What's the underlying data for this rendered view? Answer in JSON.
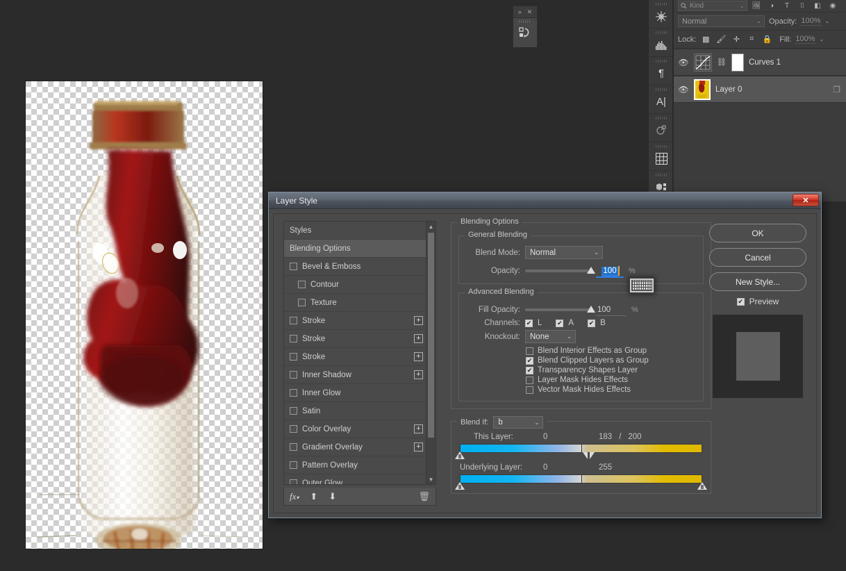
{
  "app": {
    "background_color": "#2b2b2b",
    "accent_color": "#2472c8"
  },
  "mini_panel": {
    "name": "actions-panel-collapsed",
    "expand_icon": "double-chevron-right-icon",
    "close_icon": "close-icon",
    "body_icon": "actions-icon"
  },
  "rail": {
    "items": [
      {
        "name": "color-panel",
        "glyph": "✳"
      },
      {
        "name": "histogram-panel",
        "glyph": "▥"
      },
      {
        "name": "paragraph-panel",
        "glyph": "¶"
      },
      {
        "name": "character-panel",
        "glyph": "A"
      },
      {
        "name": "paths-panel",
        "glyph": "⊛"
      },
      {
        "name": "swatches-panel",
        "glyph": "▦"
      },
      {
        "name": "3d-panel",
        "glyph": "◈"
      }
    ]
  },
  "layers_panel": {
    "filter": {
      "search_icon": "search-icon",
      "kind_label": "Kind",
      "chevron": "⌄",
      "type_icons": [
        "pixel-filter-icon",
        "adjustment-filter-icon",
        "type-filter-icon",
        "shape-filter-icon",
        "smart-object-filter-icon",
        "filter-toggle-icon"
      ]
    },
    "blend_mode": "Normal",
    "opacity_label": "Opacity:",
    "opacity_value": "100%",
    "lock_label": "Lock:",
    "lock_icons": [
      "lock-transparency-icon",
      "lock-image-icon",
      "lock-position-icon",
      "lock-artboard-icon",
      "lock-all-icon"
    ],
    "fill_label": "Fill:",
    "fill_value": "100%",
    "layers": [
      {
        "name": "Curves 1",
        "visible_icon": "eye-icon",
        "thumb": "curves-adjustment-icon",
        "link_icon": "link-icon",
        "has_mask": true,
        "selected": false,
        "clipped": false
      },
      {
        "name": "Layer 0",
        "visible_icon": "eye-icon",
        "thumb": "layer-thumbnail",
        "selected": true,
        "clipped": true,
        "clip_icon": "clipping-mask-icon"
      }
    ]
  },
  "dialog": {
    "title": "Layer Style",
    "close_icon": "close-icon",
    "styles": {
      "header": "Styles",
      "items": [
        {
          "label": "Blending Options",
          "checkbox": false,
          "active": true,
          "plus": false,
          "indent": false
        },
        {
          "label": "Bevel & Emboss",
          "checkbox": true,
          "checked": false,
          "plus": false,
          "indent": false
        },
        {
          "label": "Contour",
          "checkbox": true,
          "checked": false,
          "plus": false,
          "indent": true
        },
        {
          "label": "Texture",
          "checkbox": true,
          "checked": false,
          "plus": false,
          "indent": true
        },
        {
          "label": "Stroke",
          "checkbox": true,
          "checked": false,
          "plus": true,
          "indent": false
        },
        {
          "label": "Stroke",
          "checkbox": true,
          "checked": false,
          "plus": true,
          "indent": false
        },
        {
          "label": "Stroke",
          "checkbox": true,
          "checked": false,
          "plus": true,
          "indent": false
        },
        {
          "label": "Inner Shadow",
          "checkbox": true,
          "checked": false,
          "plus": true,
          "indent": false
        },
        {
          "label": "Inner Glow",
          "checkbox": true,
          "checked": false,
          "plus": false,
          "indent": false
        },
        {
          "label": "Satin",
          "checkbox": true,
          "checked": false,
          "plus": false,
          "indent": false
        },
        {
          "label": "Color Overlay",
          "checkbox": true,
          "checked": false,
          "plus": true,
          "indent": false
        },
        {
          "label": "Gradient Overlay",
          "checkbox": true,
          "checked": false,
          "plus": true,
          "indent": false
        },
        {
          "label": "Pattern Overlay",
          "checkbox": true,
          "checked": false,
          "plus": false,
          "indent": false
        },
        {
          "label": "Outer Glow",
          "checkbox": true,
          "checked": false,
          "plus": false,
          "indent": false
        }
      ],
      "footer": {
        "fx_icon": "fx-icon",
        "up_icon": "move-up-icon",
        "down_icon": "move-down-icon",
        "delete_icon": "trash-icon"
      },
      "scroll_up_icon": "chevron-up-icon",
      "scroll_down_icon": "chevron-down-icon"
    },
    "blending_options": {
      "legend": "Blending Options",
      "general": {
        "legend": "General Blending",
        "blend_mode_label": "Blend Mode:",
        "blend_mode_value": "Normal",
        "opacity_label": "Opacity:",
        "opacity_value": "100",
        "opacity_unit": "%",
        "opacity_selected": true
      },
      "advanced": {
        "legend": "Advanced Blending",
        "fill_opacity_label": "Fill Opacity:",
        "fill_opacity_value": "100",
        "fill_opacity_unit": "%",
        "channels_label": "Channels:",
        "channels": [
          {
            "label": "L",
            "checked": true
          },
          {
            "label": "A",
            "checked": true
          },
          {
            "label": "B",
            "checked": true
          }
        ],
        "knockout_label": "Knockout:",
        "knockout_value": "None",
        "checkboxes": [
          {
            "label": "Blend Interior Effects as Group",
            "checked": false
          },
          {
            "label": "Blend Clipped Layers as Group",
            "checked": true
          },
          {
            "label": "Transparency Shapes Layer",
            "checked": true
          },
          {
            "label": "Layer Mask Hides Effects",
            "checked": false
          },
          {
            "label": "Vector Mask Hides Effects",
            "checked": false
          }
        ]
      },
      "blend_if": {
        "label": "Blend If:",
        "channel": "b",
        "this_layer": {
          "label": "This Layer:",
          "black": "0",
          "white_low": "183",
          "separator": "/",
          "white_high": "200",
          "black_pos_pct": 0,
          "white_low_pct": 72,
          "white_high_pct": 79
        },
        "underlying_layer": {
          "label": "Underlying Layer:",
          "black": "0",
          "white": "255",
          "black_pos_pct": 0,
          "white_pos_pct": 100
        },
        "gradient_start_color": "#00b0f0",
        "gradient_end_color": "#e0b900"
      }
    },
    "buttons": {
      "ok": "OK",
      "cancel": "Cancel",
      "new_style": "New Style...",
      "preview_label": "Preview",
      "preview_checked": true
    }
  },
  "cursor": {
    "keyboard_overlay_icon": "keyboard-icon"
  }
}
